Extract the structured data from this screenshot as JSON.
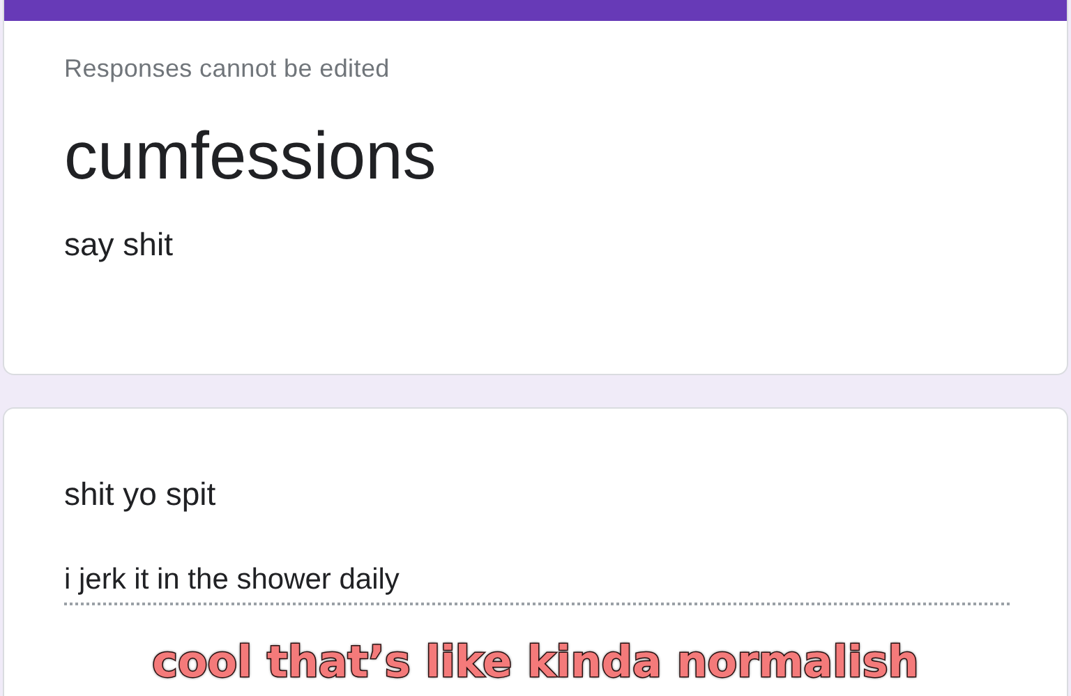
{
  "header_card": {
    "notice": "Responses cannot be edited",
    "title": "cumfessions",
    "description": "say shit"
  },
  "question_card": {
    "question": "shit yo spit",
    "answer": {
      "value": "i jerk it in the shower daily"
    }
  },
  "caption": "cool that’s like kinda normalish"
}
